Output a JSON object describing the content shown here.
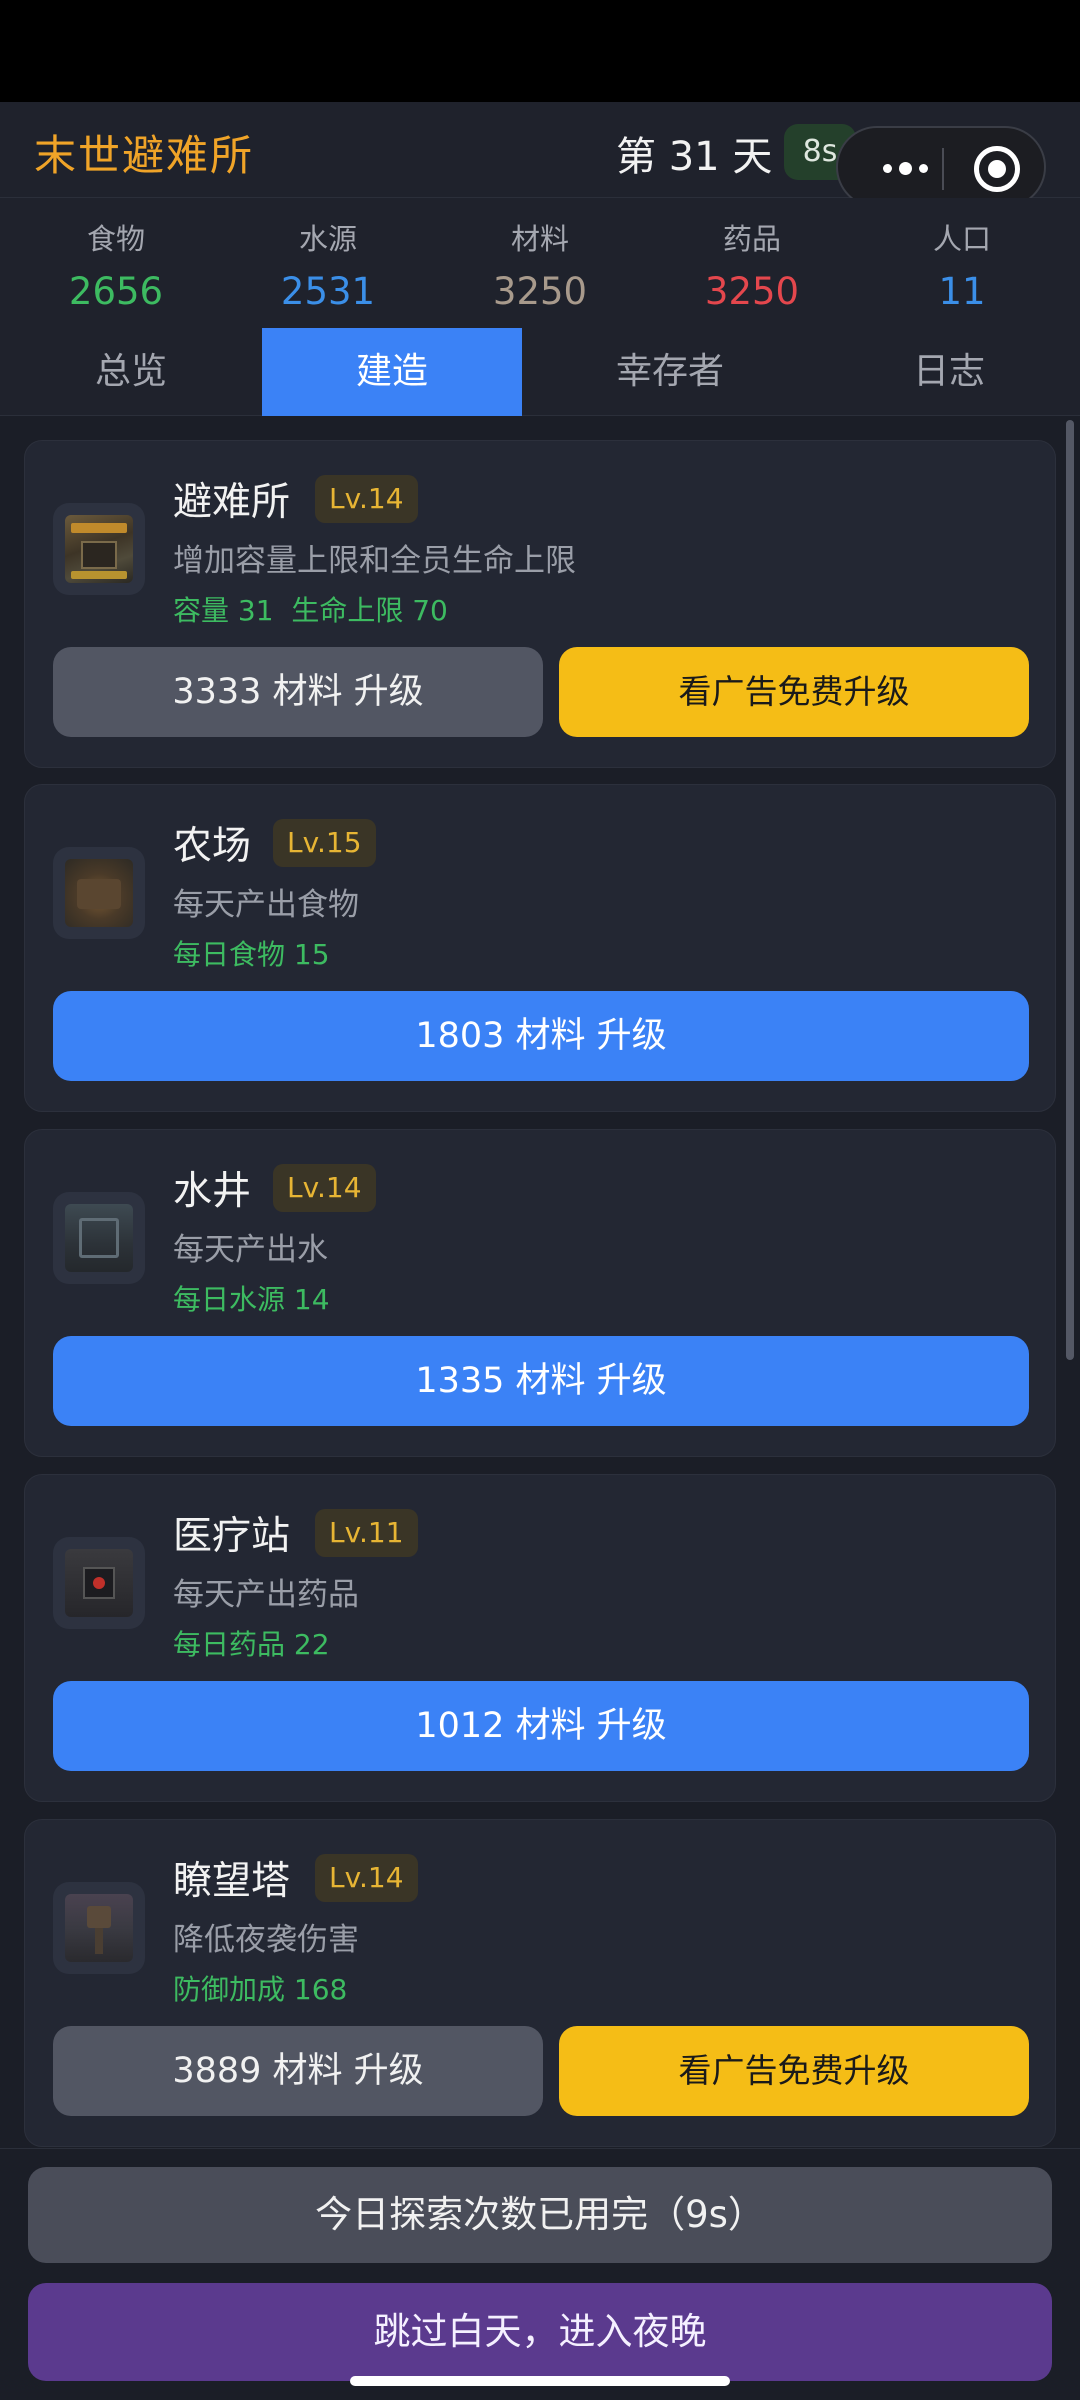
{
  "app": {
    "title": "末世避难所",
    "day": "第 31 天",
    "timer": "8s"
  },
  "capsule": {
    "more_icon": "more-dots-icon",
    "close_icon": "target-icon"
  },
  "stats": [
    {
      "label": "食物",
      "value": "2656",
      "color": "#3dbb61"
    },
    {
      "label": "水源",
      "value": "2531",
      "color": "#3b8fe8"
    },
    {
      "label": "材料",
      "value": "3250",
      "color": "#a89a8c"
    },
    {
      "label": "药品",
      "value": "3250",
      "color": "#e4474d"
    },
    {
      "label": "人口",
      "value": "11",
      "color": "#3b8fe8"
    }
  ],
  "tabs": [
    {
      "label": "总览",
      "active": false
    },
    {
      "label": "建造",
      "active": true
    },
    {
      "label": "幸存者",
      "active": false
    },
    {
      "label": "日志",
      "active": false
    }
  ],
  "buildings": [
    {
      "name": "避难所",
      "level": "Lv.14",
      "desc": "增加容量上限和全员生命上限",
      "effect": "容量 31  生命上限 70",
      "upgrade_label": "3333 材料 升级",
      "ad_label": "看广告免费升级",
      "icon": "shelter-image"
    },
    {
      "name": "农场",
      "level": "Lv.15",
      "desc": "每天产出食物",
      "effect": "每日食物 15",
      "upgrade_label": "1803 材料 升级",
      "icon": "farm-image"
    },
    {
      "name": "水井",
      "level": "Lv.14",
      "desc": "每天产出水",
      "effect": "每日水源 14",
      "upgrade_label": "1335 材料 升级",
      "icon": "well-image"
    },
    {
      "name": "医疗站",
      "level": "Lv.11",
      "desc": "每天产出药品",
      "effect": "每日药品 22",
      "upgrade_label": "1012 材料 升级",
      "icon": "medical-image"
    },
    {
      "name": "瞭望塔",
      "level": "Lv.14",
      "desc": "降低夜袭伤害",
      "effect": "防御加成 168",
      "upgrade_label": "3889 材料 升级",
      "ad_label": "看广告免费升级",
      "icon": "watchtower-image"
    }
  ],
  "bottom": {
    "explore_label": "今日探索次数已用完（9s）",
    "night_label": "跳过白天，进入夜晚"
  },
  "colors": {
    "accent": "#3b82f6",
    "title": "#f0a428",
    "level": "#e7b534",
    "effect": "#3dbb61",
    "ad_button": "#f5bd16",
    "night_button": "#5b3a8e"
  }
}
